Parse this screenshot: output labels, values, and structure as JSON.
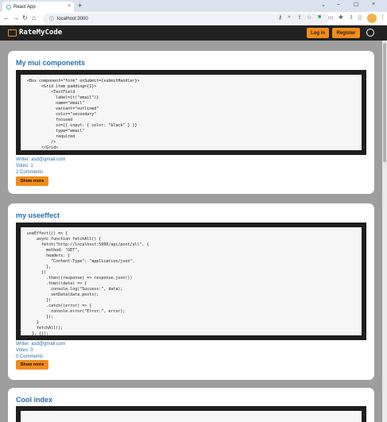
{
  "browser": {
    "tab_title": "React App",
    "tab_close": "×",
    "new_tab": "+",
    "url": "localhost:3000",
    "window_controls": [
      "⌄",
      "–",
      "☐",
      "×"
    ]
  },
  "app": {
    "brand": "RateMyCode",
    "login_label": "Log in",
    "register_label": "Register",
    "accent": "#f28c1a",
    "title_color": "#2a6fb3"
  },
  "posts": [
    {
      "title": "My mui components",
      "code": "<Box component=\"form\" onSubmit={submitHandler}>\n      <Grid item padding={1}>\n          <TextField\n            label={t(\"email\")}\n            name=\"email\"\n            variant=\"outlined\"\n            color=\"secondary\"\n            focused\n            sx={{ input: { color: \"black\" } }}\n            type=\"email\"\n            required\n          />\n      </Grid>",
      "writer": "Writer: asd@gmail.com",
      "votes": "Votes: 1",
      "comments": "2 Comments",
      "show_more": "Show more"
    },
    {
      "title": "my useeffect",
      "code": "useEffect(() => {\n    async function fetchAll() {\n      fetch(\"http://localhost:5000/api/post/all\", {\n        method: \"GET\",\n        headers: {\n          \"Content-Type\": \"application/json\",\n        },\n      })\n        .then((response) => response.json())\n        .then((data) => {\n          console.log(\"Success:\", data);\n          setData(data.posts);\n        })\n        .catch((error) => {\n          console.error(\"Error:\", error);\n        });\n    }\n    fetchAll();\n  }, []);",
      "writer": "Writer: asd@gmail.com",
      "votes": "Votes: 0",
      "comments": "0 Comments",
      "show_more": "Show more"
    },
    {
      "title": "Cool index"
    }
  ]
}
